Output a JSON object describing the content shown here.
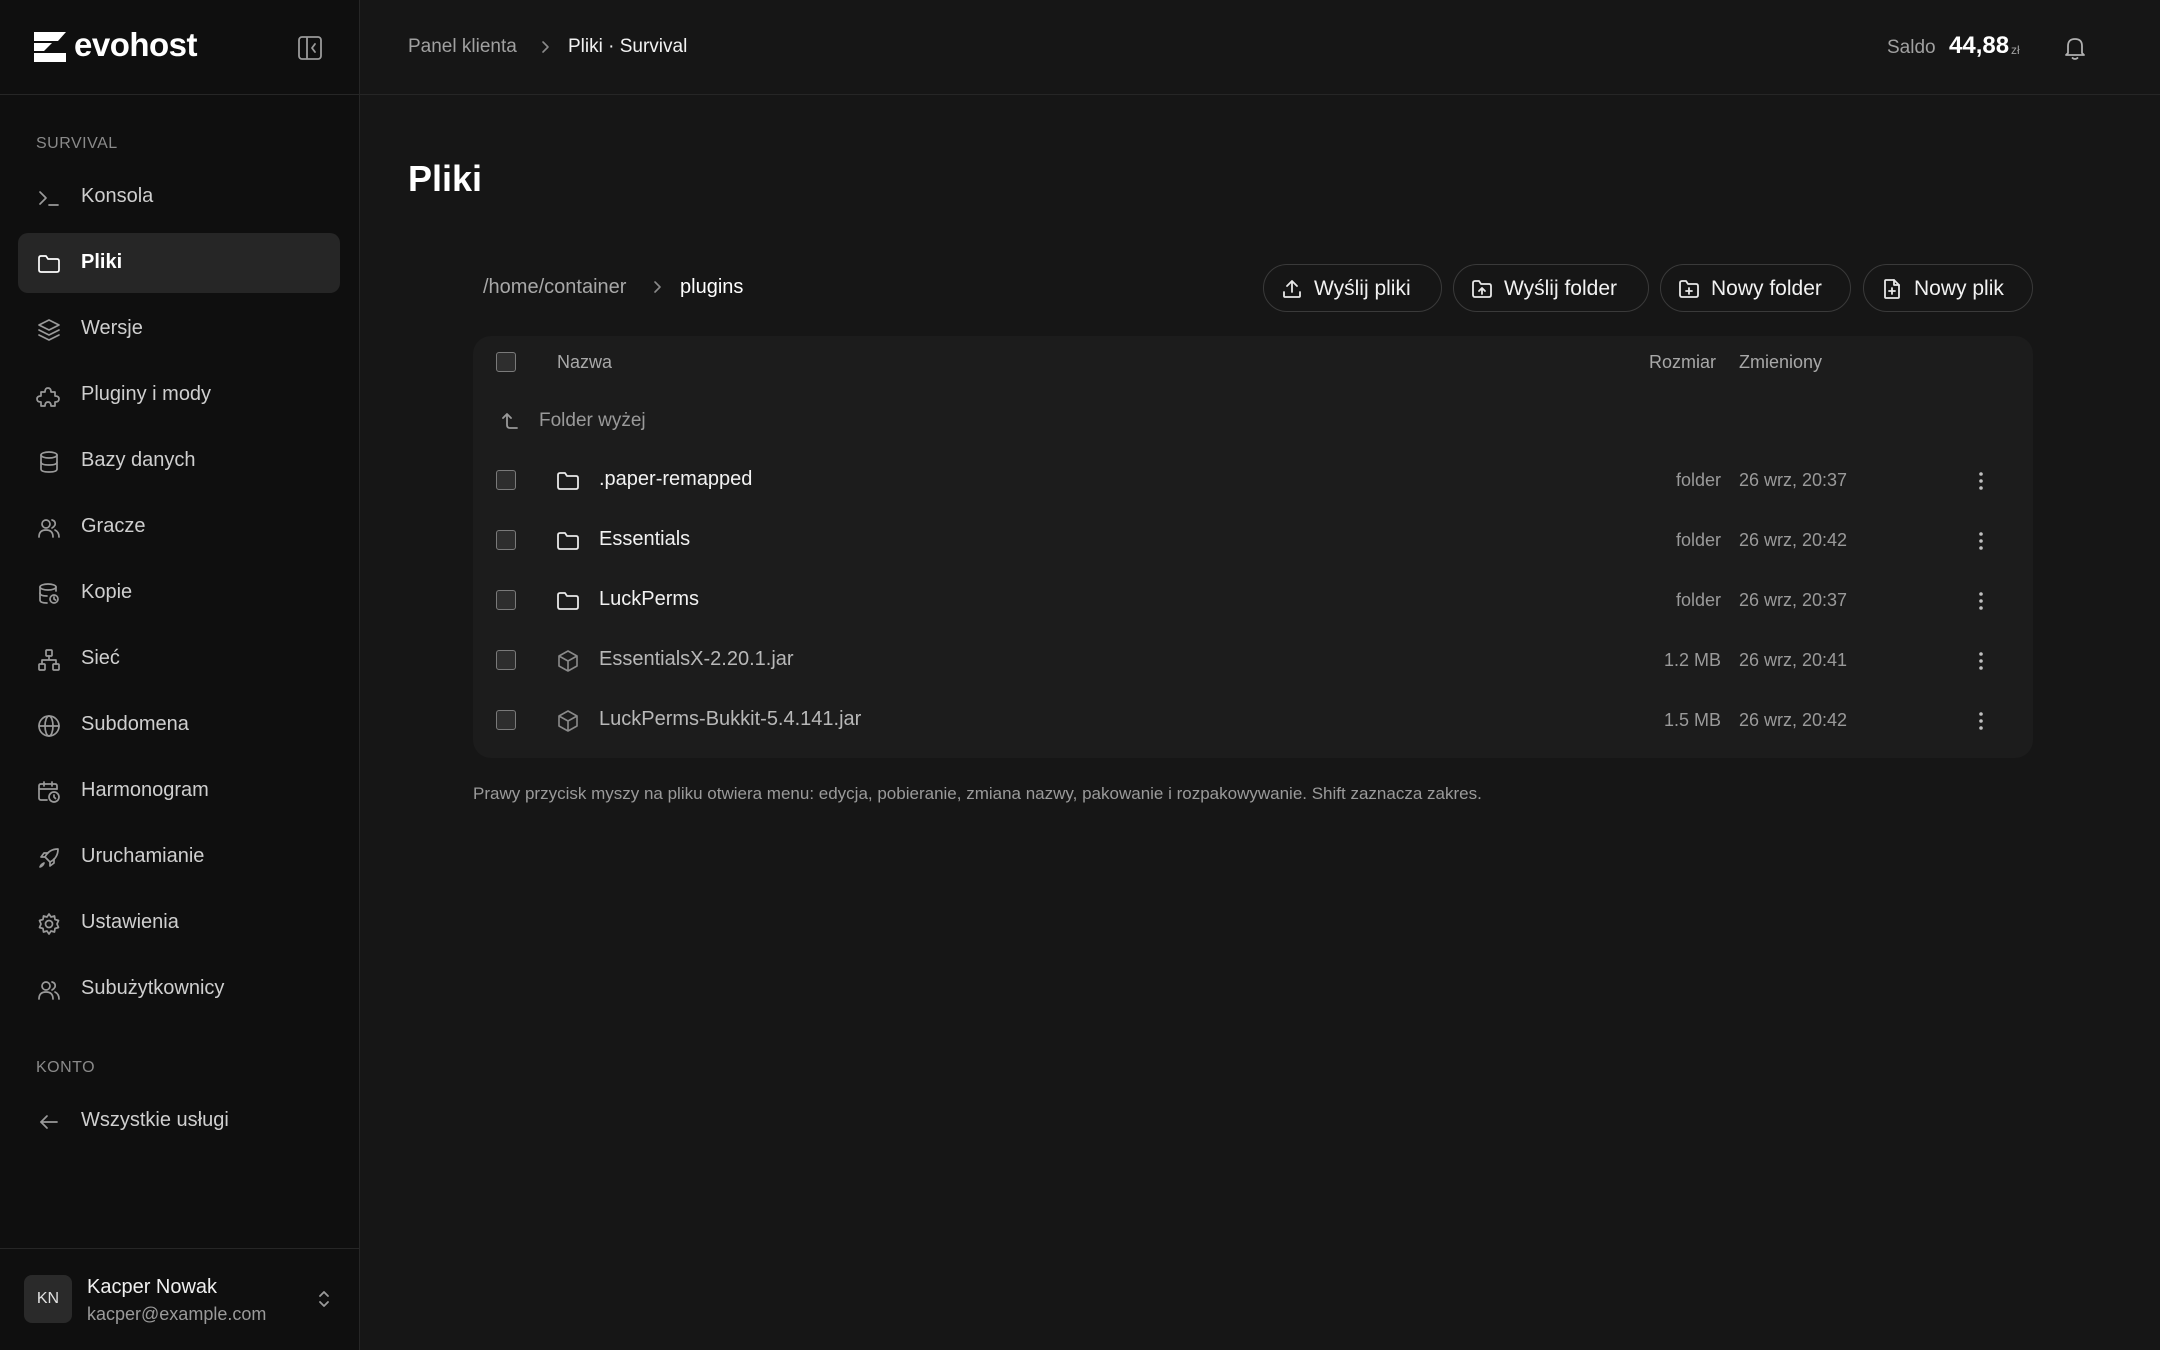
{
  "brand": {
    "name": "evohost"
  },
  "sidebar": {
    "section_server": "SURVIVAL",
    "items": [
      {
        "label": "Konsola",
        "icon": "terminal-icon"
      },
      {
        "label": "Pliki",
        "icon": "folder-icon",
        "active": true
      },
      {
        "label": "Wersje",
        "icon": "layers-icon"
      },
      {
        "label": "Pluginy i mody",
        "icon": "puzzle-icon"
      },
      {
        "label": "Bazy danych",
        "icon": "database-icon"
      },
      {
        "label": "Gracze",
        "icon": "users-icon"
      },
      {
        "label": "Kopie",
        "icon": "database-backup-icon"
      },
      {
        "label": "Sieć",
        "icon": "network-icon"
      },
      {
        "label": "Subdomena",
        "icon": "globe-icon"
      },
      {
        "label": "Harmonogram",
        "icon": "calendar-clock-icon"
      },
      {
        "label": "Uruchamianie",
        "icon": "rocket-icon"
      },
      {
        "label": "Ustawienia",
        "icon": "gear-icon"
      },
      {
        "label": "Subużytkownicy",
        "icon": "users-icon"
      }
    ],
    "section_account": "KONTO",
    "account_items": [
      {
        "label": "Wszystkie usługi",
        "icon": "arrow-left-icon"
      }
    ]
  },
  "user": {
    "initials": "KN",
    "name": "Kacper Nowak",
    "email": "kacper@example.com"
  },
  "topbar": {
    "breadcrumb_parent": "Panel klienta",
    "breadcrumb_current": "Pliki · Survival",
    "saldo_label": "Saldo",
    "saldo_value": "44,88",
    "saldo_unit": "zł"
  },
  "main": {
    "title": "Pliki",
    "path_root": "/home/container",
    "path_current": "plugins",
    "buttons": {
      "upload_files": "Wyślij pliki",
      "upload_folder": "Wyślij folder",
      "new_folder": "Nowy folder",
      "new_file": "Nowy plik"
    },
    "table": {
      "col_name": "Nazwa",
      "col_size": "Rozmiar",
      "col_modified": "Zmieniony",
      "up_label": "Folder wyżej",
      "rows": [
        {
          "name": ".paper-remapped",
          "type": "folder",
          "size": "folder",
          "modified": "26 wrz, 20:37"
        },
        {
          "name": "Essentials",
          "type": "folder",
          "size": "folder",
          "modified": "26 wrz, 20:42"
        },
        {
          "name": "LuckPerms",
          "type": "folder",
          "size": "folder",
          "modified": "26 wrz, 20:37"
        },
        {
          "name": "EssentialsX-2.20.1.jar",
          "type": "file",
          "size": "1.2 MB",
          "modified": "26 wrz, 20:41"
        },
        {
          "name": "LuckPerms-Bukkit-5.4.141.jar",
          "type": "file",
          "size": "1.5 MB",
          "modified": "26 wrz, 20:42"
        }
      ]
    },
    "hint": "Prawy przycisk myszy na pliku otwiera menu: edycja, pobieranie, zmiana nazwy, pakowanie i rozpakowywanie. Shift zaznacza zakres."
  }
}
